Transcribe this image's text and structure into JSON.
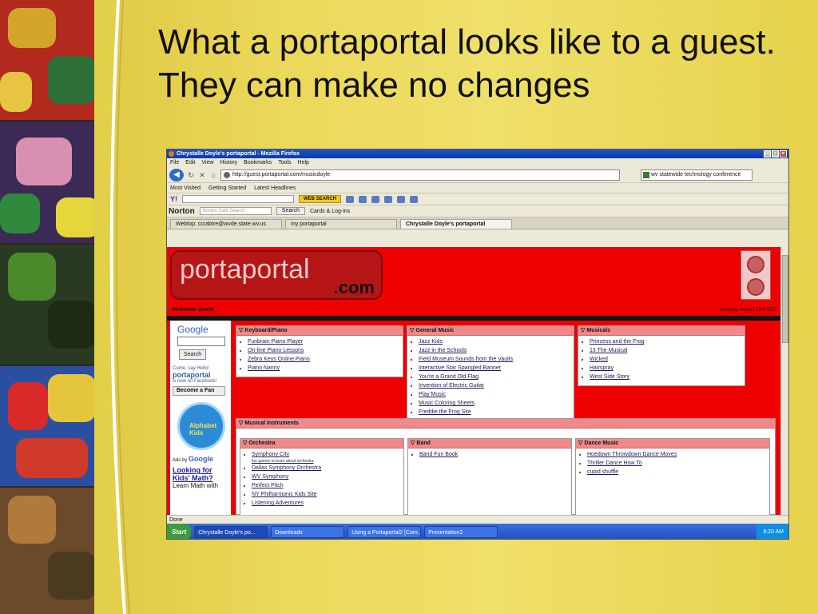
{
  "slide": {
    "title": "What a portaportal looks like to a guest.  They can make no changes"
  },
  "browser": {
    "window_title": "Chrystalle Doyle's portaportal - Mozilla Firefox",
    "menu": [
      "File",
      "Edit",
      "View",
      "History",
      "Bookmarks",
      "Tools",
      "Help"
    ],
    "url": "http://guest.portaportal.com/musicdoyle",
    "search_value": "wv statewide technology conference",
    "bookmarks": [
      "Most Visited",
      "Getting Started",
      "Latest Headlines"
    ],
    "yahoo": {
      "logo": "Y!",
      "button": "WEB SEARCH"
    },
    "norton": {
      "logo": "Norton",
      "placeholder": "Norton Safe Search",
      "search_label": "Search",
      "cards_label": "Cards & Log-ins"
    },
    "tabs": [
      "Webtop: ccrabtre@wvde.state.wv.us",
      "my portaportal",
      "Chrystalle Doyle's portaportal"
    ],
    "status": "Done",
    "taskbar": {
      "start": "Start",
      "items": [
        "Chrystalle Doyle's po...",
        "Downloads",
        "Using a Portaportal2 [Com...",
        "Presentation2"
      ],
      "clock": "8:20 AM"
    }
  },
  "portal": {
    "logo_main": "portaportal",
    "logo_sub": ".com",
    "welcome": "Welcome Guest",
    "date": "Tuesday, August 03rd 2010",
    "sidebar": {
      "google": "Google",
      "search_button": "Search",
      "fb_hello": "Come, say Hello!",
      "fb_name": "portaportal",
      "fb_now": "is now on Facebook!",
      "fan_button": "Become a Fan",
      "kids_label": "Alphabet Kids",
      "ads_by": "Ads by",
      "ads_google": "Google",
      "ad_title": "Looking for Kids' Math?",
      "ad_text": "Learn Math with"
    },
    "panels": {
      "keyboard": {
        "title": "Keyboard/Piano",
        "items": [
          "Funbrain Piano Player",
          "On-line Piano Lessons",
          "Zebra Keys Online Piano",
          "Piano Nanny"
        ]
      },
      "general": {
        "title": "General Music",
        "items": [
          "Jazz Kids",
          "Jazz in the Schools",
          "Field Museum Sounds from the Vaults",
          "Interactive Star Spangled Banner",
          "You're a Grand Old Flag",
          "Invention of Electric Guitar",
          "Play Music",
          "Music Coloring Sheets",
          "Freddie the Frog Site"
        ]
      },
      "musicals": {
        "title": "Musicals",
        "items": [
          "Princess and the Frog",
          "13 The Musical",
          "Wicked",
          "Hairspray",
          "West Side Story"
        ]
      },
      "instruments": {
        "title": "Musical Instruments"
      },
      "orchestra": {
        "title": "Orchestra",
        "items": [
          "Symphony City",
          "Dallas Symphony Orchestra",
          "WV Symphony",
          "Perfect Pitch",
          "NY Philharmonic Kids Site",
          "Listening Adventures"
        ],
        "note": "fun games to learn about orchestra"
      },
      "band": {
        "title": "Band",
        "items": [
          "Band Fun Book"
        ]
      },
      "dance": {
        "title": "Dance Music",
        "items": [
          "Hoedown Throwdown Dance Moves",
          "Thriller Dance How To",
          "cupid shuffle"
        ]
      }
    }
  }
}
